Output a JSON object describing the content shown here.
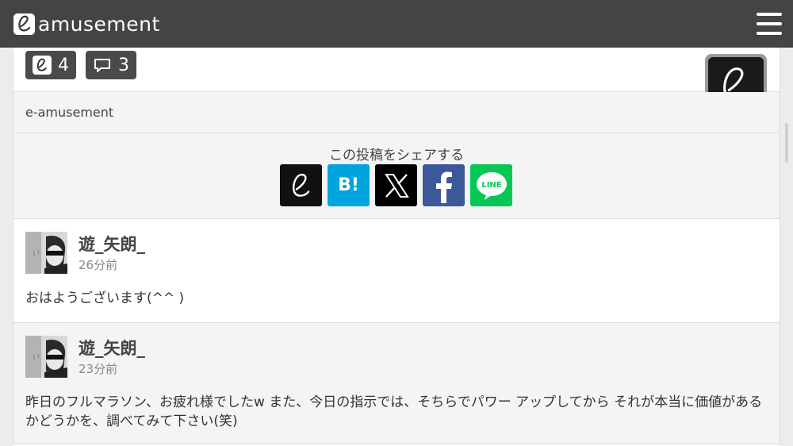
{
  "header": {
    "logo_text": "amusement",
    "logo_icon": "e-logo-icon",
    "menu_icon": "hamburger-menu-icon"
  },
  "stats": {
    "likes_count": "4",
    "comments_count": "3"
  },
  "post": {
    "author": "e-amusement"
  },
  "share": {
    "title": "この投稿をシェアする",
    "hatena_label": "B!",
    "line_label": "LINE",
    "services": [
      "e-amusement",
      "hatena-bookmark",
      "x",
      "facebook",
      "line"
    ]
  },
  "comments": [
    {
      "name": "遊_矢朗_",
      "time": "26分前",
      "text": "おはようございます(^^ )"
    },
    {
      "name": "遊_矢朗_",
      "time": "23分前",
      "text": "昨日のフルマラソン、お疲れ様でしたw また、今日の指示では、そちらでパワー アップしてから それが本当に価値があるかどうかを、調べてみて下さい(笑)"
    }
  ],
  "colors": {
    "header_bg": "#444444",
    "badge_bg": "#4a4a4a",
    "hatena": "#00a4de",
    "x": "#000000",
    "facebook": "#3b5998",
    "line": "#06c755"
  }
}
